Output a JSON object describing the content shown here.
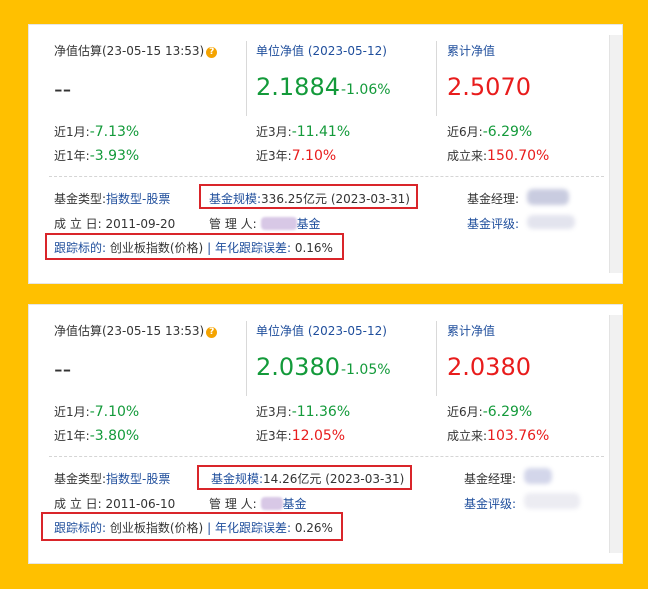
{
  "cards": [
    {
      "estimate_label": "净值估算(23-05-15 13:53)",
      "estimate_value": "--",
      "unit_nav_label": "单位净值 (2023-05-12)",
      "unit_nav_value": "2.1884",
      "unit_nav_change": "-1.06%",
      "cum_nav_label": "累计净值",
      "cum_nav_value": "2.5070",
      "stats": [
        {
          "label": "近1月:",
          "value": "-7.13%"
        },
        {
          "label": "近3月:",
          "value": "-11.41%"
        },
        {
          "label": "近6月:",
          "value": "-6.29%"
        },
        {
          "label": "近1年:",
          "value": "-3.93%"
        },
        {
          "label": "近3年:",
          "value": "7.10%"
        },
        {
          "label": "成立来:",
          "value": "150.70%"
        }
      ],
      "fund_type_label": "基金类型:",
      "fund_type_value": "指数型-股票",
      "scale_label": "基金规模:",
      "scale_value": "336.25亿元 (2023-03-31)",
      "manager_label": "基金经理:",
      "inception_label": "成 立 日:",
      "inception_value": "2011-09-20",
      "custodian_label": "管 理 人:",
      "custodian_value": "基金",
      "rating_label": "基金评级:",
      "tracking_label": "跟踪标的:",
      "tracking_value": "创业板指数(价格)",
      "tracking_sep": "|",
      "tracking_error_label": "年化跟踪误差:",
      "tracking_error_value": "0.16%"
    },
    {
      "estimate_label": "净值估算(23-05-15 13:53)",
      "estimate_value": "--",
      "unit_nav_label": "单位净值 (2023-05-12)",
      "unit_nav_value": "2.0380",
      "unit_nav_change": "-1.05%",
      "cum_nav_label": "累计净值",
      "cum_nav_value": "2.0380",
      "stats": [
        {
          "label": "近1月:",
          "value": "-7.10%"
        },
        {
          "label": "近3月:",
          "value": "-11.36%"
        },
        {
          "label": "近6月:",
          "value": "-6.29%"
        },
        {
          "label": "近1年:",
          "value": "-3.80%"
        },
        {
          "label": "近3年:",
          "value": "12.05%"
        },
        {
          "label": "成立来:",
          "value": "103.76%"
        }
      ],
      "fund_type_label": "基金类型:",
      "fund_type_value": "指数型-股票",
      "scale_label": "基金规模:",
      "scale_value": "14.26亿元 (2023-03-31)",
      "manager_label": "基金经理:",
      "inception_label": "成 立 日:",
      "inception_value": "2011-06-10",
      "custodian_label": "管 理 人:",
      "custodian_value": "基金",
      "rating_label": "基金评级:",
      "tracking_label": "跟踪标的:",
      "tracking_value": "创业板指数(价格)",
      "tracking_sep": "|",
      "tracking_error_label": "年化跟踪误差:",
      "tracking_error_value": "0.26%"
    }
  ],
  "colors": {
    "background": "#FFC000",
    "positive": "#e81c1c",
    "negative": "#139a3a",
    "link": "#1f4e9c",
    "highlight": "#d9252a"
  }
}
